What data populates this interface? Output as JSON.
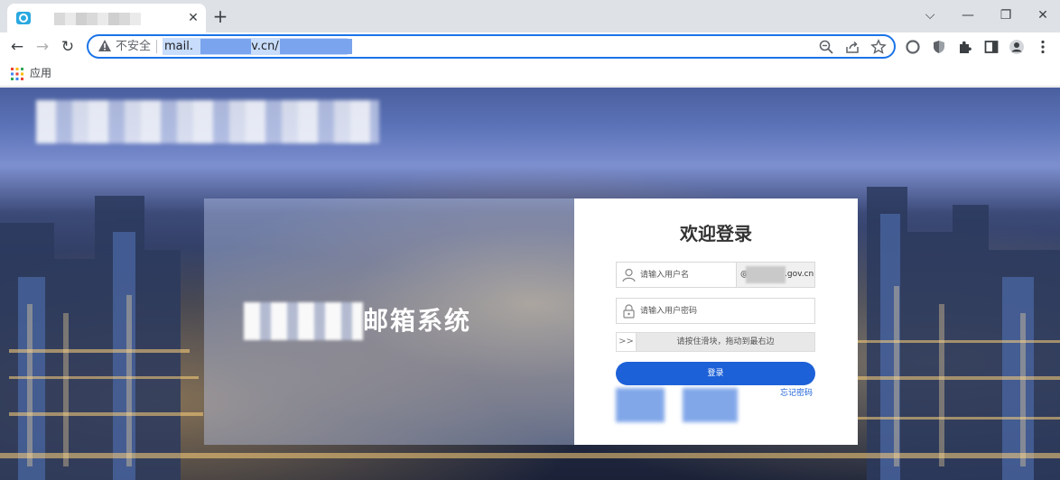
{
  "browser": {
    "tab": {
      "title": ""
    },
    "new_tab_symbol": "+",
    "close_symbol": "✕",
    "window_controls": {
      "dropdown": "⌵",
      "minimize": "—",
      "restore": "❐",
      "close": "✕"
    },
    "nav": {
      "back": "←",
      "forward": "→",
      "reload": "↻"
    },
    "address_bar": {
      "security_label": "不安全",
      "url_start": "mail.",
      "url_mid": "gov.cn/"
    },
    "toolbar_icons": [
      "zoom-icon",
      "share-icon",
      "bookmark-star-icon",
      "extension-circle-icon",
      "shield-extension-icon",
      "puzzle-icon",
      "side-panel-icon",
      "profile-icon",
      "menu-icon"
    ],
    "bookmarks": {
      "apps_label": "应用"
    }
  },
  "page": {
    "hero_title": "邮箱系统",
    "login": {
      "title": "欢迎登录",
      "username_placeholder": "请输入用户名",
      "domain_prefix": "@",
      "domain_suffix": ".gov.cn",
      "password_placeholder": "请输入用户密码",
      "slider_handle": ">>",
      "slider_text": "请按住滑块，拖动到最右边",
      "login_button": "登录",
      "forgot_password": "忘记密码"
    }
  },
  "colors": {
    "accent": "#1d61d8",
    "address_focus": "#1a73e8",
    "tabstrip": "#dee1e6"
  }
}
